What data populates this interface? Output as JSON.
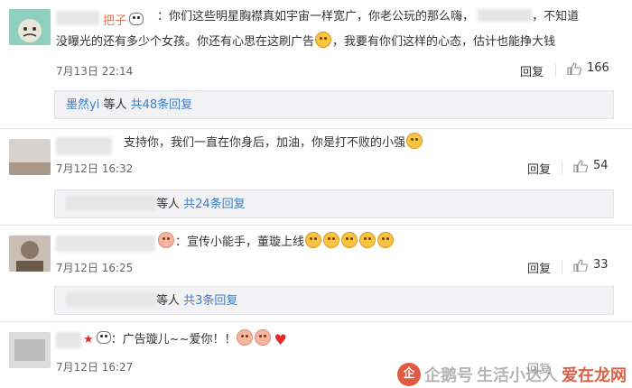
{
  "comments": [
    {
      "name": "把子",
      "text_line1": "：你们这些明星胸襟真如宇宙一样宽广，你老公玩的那么嗨，",
      "text_line1b": "，不知道",
      "text_line2a": "没曝光的还有多少个女孩。你还有心思在这刷广告",
      "text_line2b": "，我要有你们这样的心态，估计也能挣大钱",
      "time": "7月13日 22:14",
      "reply": "回复",
      "likes": "166",
      "thread": {
        "prefix": "墨然yi",
        "middle": " 等人 ",
        "link": "共48条回复"
      }
    },
    {
      "text": "支持你，我们一直在你身后，加油，你是打不败的小强",
      "time": "7月12日 16:32",
      "reply": "回复",
      "likes": "54",
      "thread": {
        "middle": "等人 ",
        "link": "共24条回复"
      }
    },
    {
      "text": "：宣传小能手，董璇上线",
      "time": "7月12日 16:25",
      "reply": "回复",
      "likes": "33",
      "thread": {
        "middle": "等人 ",
        "link": "共3条回复"
      }
    },
    {
      "text": "：广告璇儿~~爱你！！",
      "time": "7月12日 16:27",
      "reply": "回复"
    }
  ],
  "watermark": {
    "text": "企鹅号",
    "brand": "生活小达人",
    "logo_text": "企",
    "corner": "爱在龙网"
  },
  "colors": {
    "name": "#eb7350",
    "link": "#3a7ec9",
    "thread_bg": "#f2f2f5"
  }
}
